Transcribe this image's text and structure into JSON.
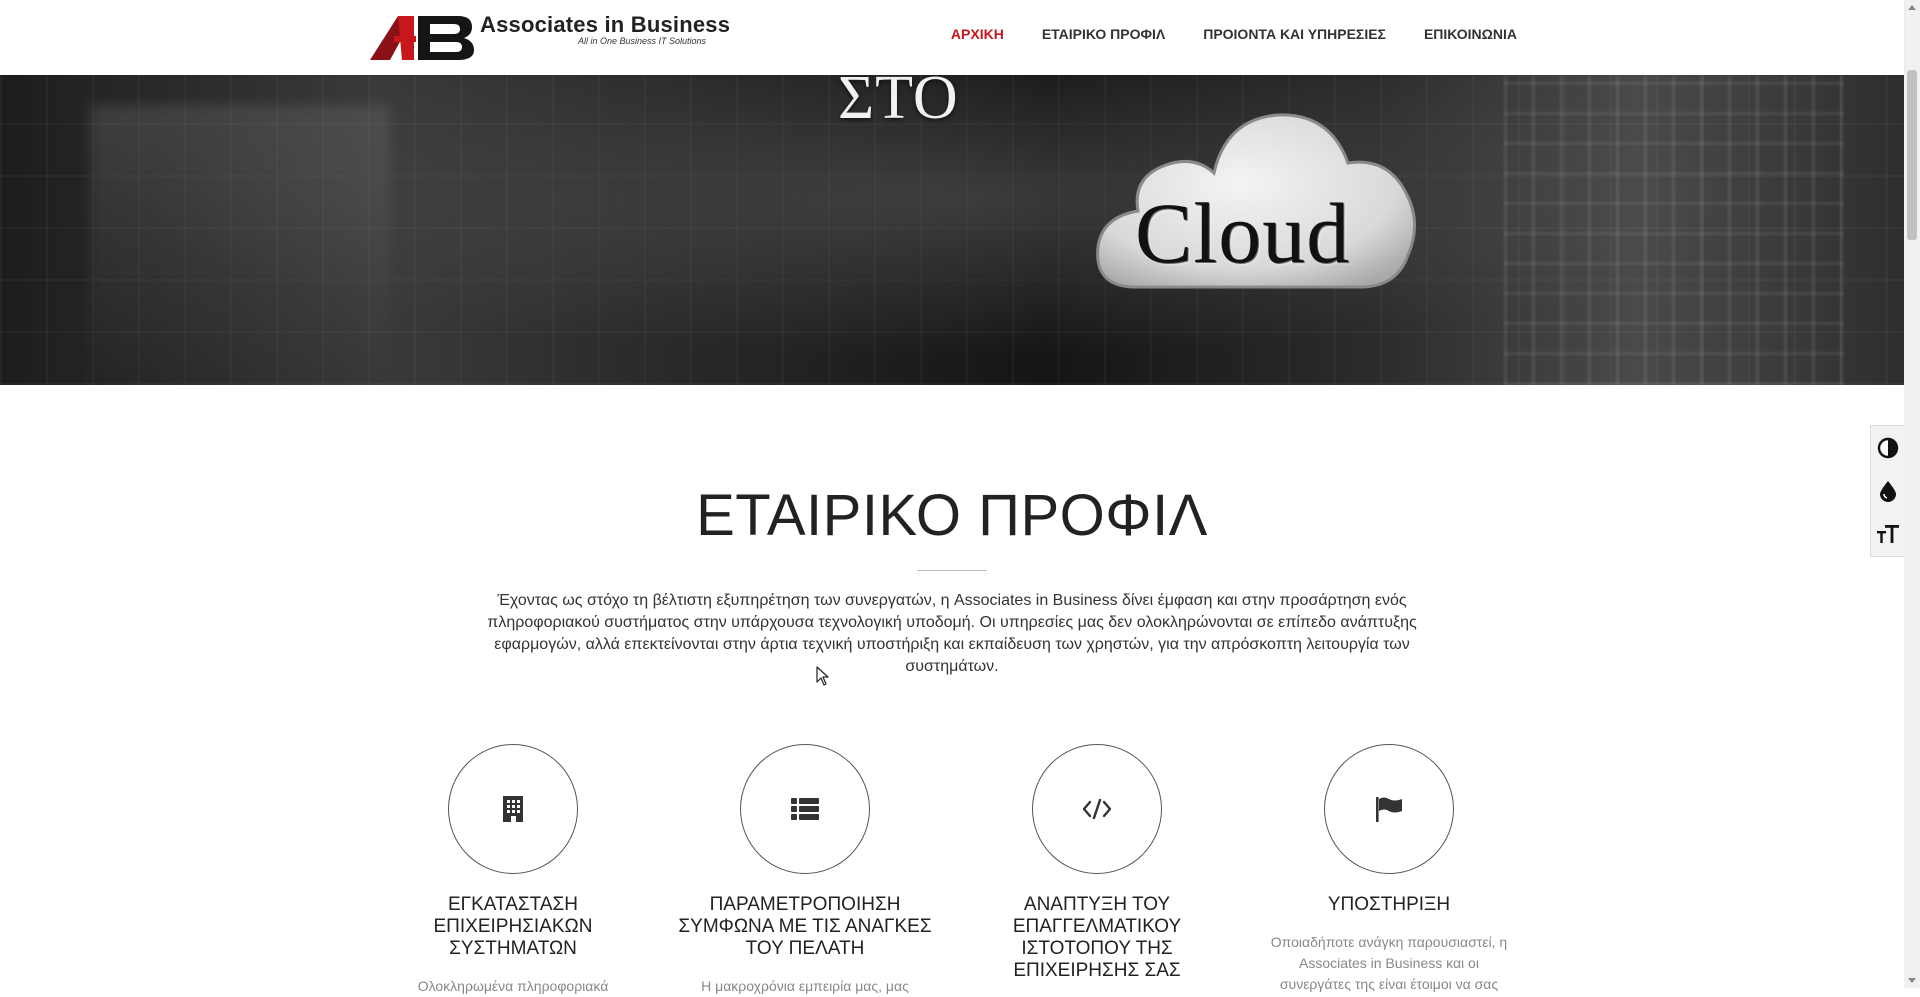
{
  "brand": {
    "name": "Associates in Business",
    "tagline": "All in One Business IT Solutions"
  },
  "nav": {
    "items": [
      {
        "label": "ΑΡΧΙΚΗ",
        "active": true
      },
      {
        "label": "ΕΤΑΙΡΙΚΟ ΠΡΟΦΙΛ",
        "active": false
      },
      {
        "label": "ΠΡΟΙΟΝΤΑ ΚΑΙ ΥΠΗΡΕΣΙΕΣ",
        "active": false
      },
      {
        "label": "ΕΠΙΚΟΙΝΩΝΙΑ",
        "active": false
      }
    ]
  },
  "hero": {
    "heading_fragment": "ΣΤΟ",
    "cloud_word": "Cloud"
  },
  "profile": {
    "title": "ΕΤΑΙΡΙΚΟ ΠΡΟΦΙΛ",
    "intro": "Έχοντας ως στόχο τη βέλτιστη εξυπηρέτηση των συνεργατών, η Associates in Business δίνει έμφαση και στην προσάρτηση ενός πληροφοριακού συστήματος στην υπάρχουσα τεχνολογική υποδομή. Οι υπηρεσίες μας δεν ολοκληρώνονται σε επίπεδο ανάπτυξης εφαρμογών, αλλά επεκτείνονται στην άρτια τεχνική υποστήριξη και εκπαίδευση των χρηστών, για την απρόσκοπτη λειτουργία των συστημάτων.",
    "features": [
      {
        "icon": "building-icon",
        "title": "ΕΓΚΑΤΑΣΤΑΣΗ ΕΠΙΧΕΙΡΗΣΙΑΚΩΝ ΣΥΣΤΗΜΑΤΩΝ",
        "text": "Ολοκληρωμένα πληροφοριακά"
      },
      {
        "icon": "list-icon",
        "title": "ΠΑΡΑΜΕΤΡΟΠΟΙΗΣΗ ΣΥΜΦΩΝΑ ΜΕ ΤΙΣ ΑΝΑΓΚΕΣ ΤΟΥ ΠΕΛΑΤΗ",
        "text": "Η μακροχρόνια εμπειρία μας, μας"
      },
      {
        "icon": "code-icon",
        "title": "ΑΝΑΠΤΥΞΗ ΤΟΥ ΕΠΑΓΓΕΛΜΑΤΙΚΟΥ ΙΣΤΟΤΟΠΟΥ ΤΗΣ ΕΠΙΧΕΙΡΗΣΗΣ ΣΑΣ",
        "text": ""
      },
      {
        "icon": "flag-icon",
        "title": "ΥΠΟΣΤΗΡΙΞΗ",
        "text": "Οποιαδήποτε ανάγκη παρουσιαστεί, η Associates in Business και οι συνεργάτες της είναι έτοιμοι να σας"
      }
    ]
  },
  "accessibility_toolbar": {
    "buttons": [
      "contrast-icon",
      "grayscale-drop-icon",
      "text-size-icon"
    ]
  },
  "colors": {
    "accent": "#c8161d",
    "text": "#222222",
    "muted": "#888888"
  }
}
